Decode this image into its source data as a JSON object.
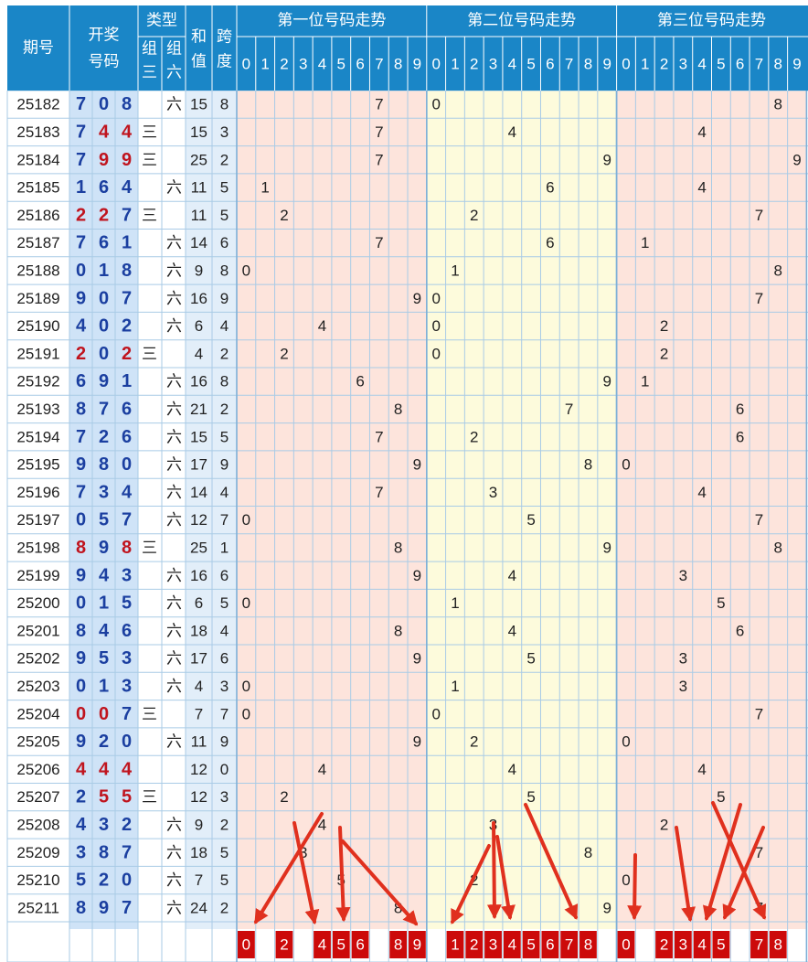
{
  "header": {
    "period_label": "期号",
    "draw_label_line1": "开奖",
    "draw_label_line2": "号码",
    "type_label": "类型",
    "type_z3": "组三",
    "type_z6": "组六",
    "sum_label": "和值",
    "span_label": "跨度",
    "pos1_title": "第一位号码走势",
    "pos2_title": "第二位号码走势",
    "pos3_title": "第三位号码走势",
    "digits": [
      "0",
      "1",
      "2",
      "3",
      "4",
      "5",
      "6",
      "7",
      "8",
      "9"
    ],
    "z3_char": "三",
    "z6_char": "六"
  },
  "colors": {
    "header_bg": "#1a86c7",
    "header_text": "#ffffff",
    "digit_blue": "#1b3fa0",
    "digit_red": "#c0141e",
    "draw_col_bg": "#cfe3f7",
    "pos1_bg": "#fde4dc",
    "pos2_bg": "#fdfbdc",
    "pos3_bg": "#fde4dc",
    "grid": "#a9cbe6",
    "selected_bg": "#cc0a0a",
    "arrow": "#e0301e"
  },
  "chart_data": {
    "type": "table",
    "title": "",
    "rows": [
      {
        "period": "25182",
        "draw": [
          7,
          0,
          8
        ],
        "type": "六",
        "sum": 15,
        "span": 8
      },
      {
        "period": "25183",
        "draw": [
          7,
          4,
          4
        ],
        "type": "三",
        "sum": 15,
        "span": 3
      },
      {
        "period": "25184",
        "draw": [
          7,
          9,
          9
        ],
        "type": "三",
        "sum": 25,
        "span": 2
      },
      {
        "period": "25185",
        "draw": [
          1,
          6,
          4
        ],
        "type": "六",
        "sum": 11,
        "span": 5
      },
      {
        "period": "25186",
        "draw": [
          2,
          2,
          7
        ],
        "type": "三",
        "sum": 11,
        "span": 5
      },
      {
        "period": "25187",
        "draw": [
          7,
          6,
          1
        ],
        "type": "六",
        "sum": 14,
        "span": 6
      },
      {
        "period": "25188",
        "draw": [
          0,
          1,
          8
        ],
        "type": "六",
        "sum": 9,
        "span": 8
      },
      {
        "period": "25189",
        "draw": [
          9,
          0,
          7
        ],
        "type": "六",
        "sum": 16,
        "span": 9
      },
      {
        "period": "25190",
        "draw": [
          4,
          0,
          2
        ],
        "type": "六",
        "sum": 6,
        "span": 4
      },
      {
        "period": "25191",
        "draw": [
          2,
          0,
          2
        ],
        "type": "三",
        "sum": 4,
        "span": 2
      },
      {
        "period": "25192",
        "draw": [
          6,
          9,
          1
        ],
        "type": "六",
        "sum": 16,
        "span": 8
      },
      {
        "period": "25193",
        "draw": [
          8,
          7,
          6
        ],
        "type": "六",
        "sum": 21,
        "span": 2
      },
      {
        "period": "25194",
        "draw": [
          7,
          2,
          6
        ],
        "type": "六",
        "sum": 15,
        "span": 5
      },
      {
        "period": "25195",
        "draw": [
          9,
          8,
          0
        ],
        "type": "六",
        "sum": 17,
        "span": 9
      },
      {
        "period": "25196",
        "draw": [
          7,
          3,
          4
        ],
        "type": "六",
        "sum": 14,
        "span": 4
      },
      {
        "period": "25197",
        "draw": [
          0,
          5,
          7
        ],
        "type": "六",
        "sum": 12,
        "span": 7
      },
      {
        "period": "25198",
        "draw": [
          8,
          9,
          8
        ],
        "type": "三",
        "sum": 25,
        "span": 1
      },
      {
        "period": "25199",
        "draw": [
          9,
          4,
          3
        ],
        "type": "六",
        "sum": 16,
        "span": 6
      },
      {
        "period": "25200",
        "draw": [
          0,
          1,
          5
        ],
        "type": "六",
        "sum": 6,
        "span": 5
      },
      {
        "period": "25201",
        "draw": [
          8,
          4,
          6
        ],
        "type": "六",
        "sum": 18,
        "span": 4
      },
      {
        "period": "25202",
        "draw": [
          9,
          5,
          3
        ],
        "type": "六",
        "sum": 17,
        "span": 6
      },
      {
        "period": "25203",
        "draw": [
          0,
          1,
          3
        ],
        "type": "六",
        "sum": 4,
        "span": 3
      },
      {
        "period": "25204",
        "draw": [
          0,
          0,
          7
        ],
        "type": "三",
        "sum": 7,
        "span": 7
      },
      {
        "period": "25205",
        "draw": [
          9,
          2,
          0
        ],
        "type": "六",
        "sum": 11,
        "span": 9
      },
      {
        "period": "25206",
        "draw": [
          4,
          4,
          4
        ],
        "type": "",
        "sum": 12,
        "span": 0
      },
      {
        "period": "25207",
        "draw": [
          2,
          5,
          5
        ],
        "type": "三",
        "sum": 12,
        "span": 3
      },
      {
        "period": "25208",
        "draw": [
          4,
          3,
          2
        ],
        "type": "六",
        "sum": 9,
        "span": 2
      },
      {
        "period": "25209",
        "draw": [
          3,
          8,
          7
        ],
        "type": "六",
        "sum": 18,
        "span": 5
      },
      {
        "period": "25210",
        "draw": [
          5,
          2,
          0
        ],
        "type": "六",
        "sum": 7,
        "span": 5
      },
      {
        "period": "25211",
        "draw": [
          8,
          9,
          7
        ],
        "type": "六",
        "sum": 24,
        "span": 2
      }
    ],
    "selected": {
      "pos1": [
        0,
        2,
        4,
        5,
        6,
        8,
        9
      ],
      "pos2": [
        1,
        2,
        3,
        4,
        5,
        6,
        7,
        8
      ],
      "pos3": [
        0,
        2,
        3,
        4,
        5,
        7,
        8
      ]
    }
  }
}
